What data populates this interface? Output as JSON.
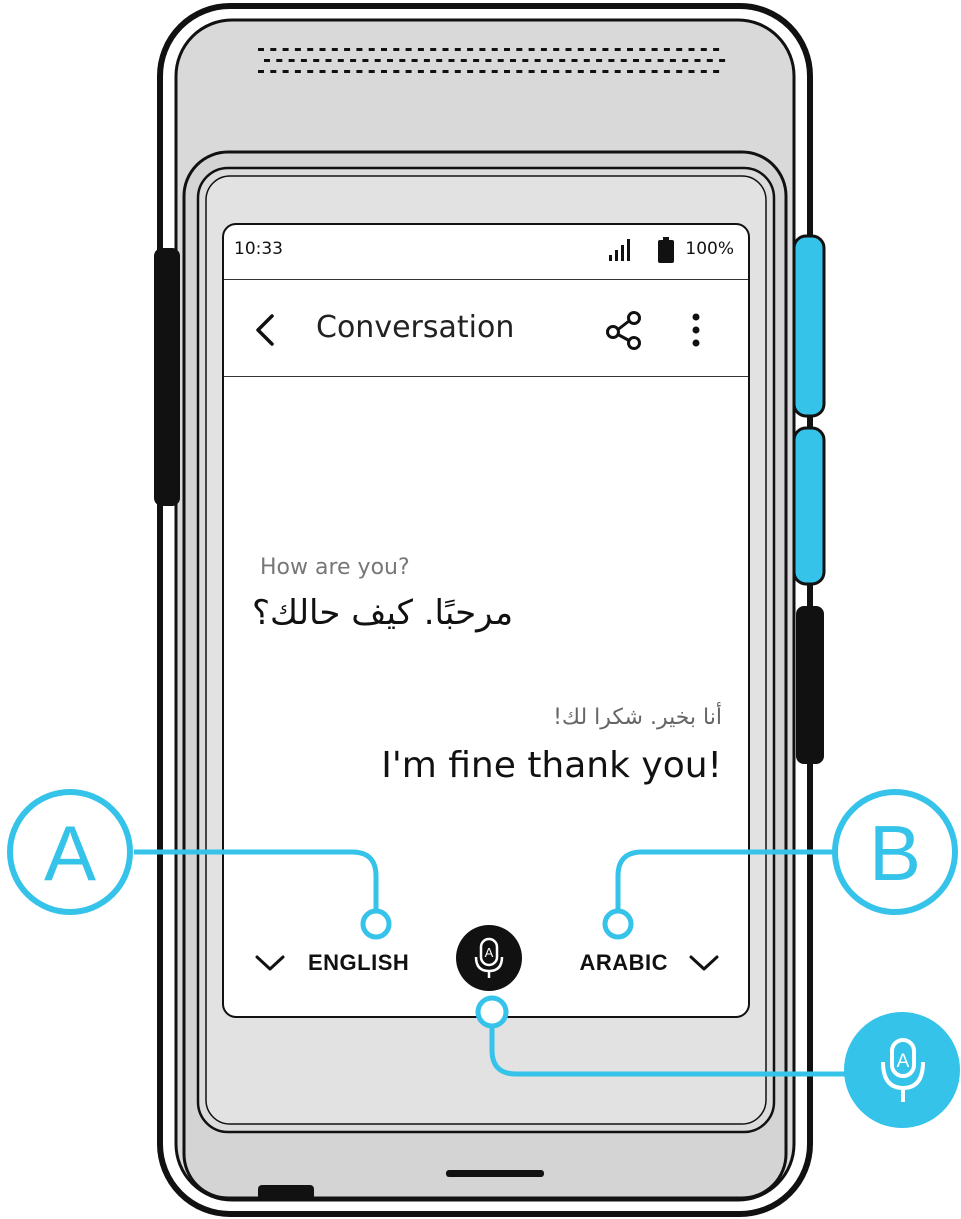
{
  "status_bar": {
    "time": "10:33",
    "battery": "100%"
  },
  "app_bar": {
    "title": "Conversation"
  },
  "conversation": {
    "messages": [
      {
        "source_text": "How are you?",
        "translation": "مرحبًا. كيف حالك؟"
      },
      {
        "source_text": "أنا بخير. شكرا لك!",
        "translation": "I'm fine thank you!"
      }
    ]
  },
  "language_bar": {
    "left_language": "ENGLISH",
    "right_language": "ARABIC"
  },
  "callouts": {
    "a": "A",
    "b": "B",
    "mic_letter": "A"
  },
  "colors": {
    "accent": "#35c3ea",
    "device_body": "#d9d9d9",
    "outline": "#111111"
  }
}
